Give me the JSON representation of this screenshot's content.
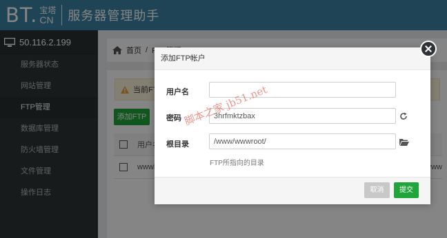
{
  "header": {
    "logo_bt": "BT.",
    "logo_cn_top": "宝塔",
    "logo_cn_bottom": "CN",
    "title": "服务器管理助手"
  },
  "sidebar": {
    "server_ip": "50.116.2.199",
    "items": [
      {
        "label": "服务器状态"
      },
      {
        "label": "网站管理"
      },
      {
        "label": "FTP管理"
      },
      {
        "label": "数据库管理"
      },
      {
        "label": "防火墙管理"
      },
      {
        "label": "文件管理"
      },
      {
        "label": "操作日志"
      }
    ],
    "active_index": 2
  },
  "breadcrumb": {
    "home": "首页",
    "separator": "/",
    "current": "FTP管理"
  },
  "main": {
    "notice_text": "当前FT",
    "add_button": "添加FTP",
    "table_header_partial": "用户名",
    "row_partial": "wwwl",
    "row_link_partial": "/www"
  },
  "modal": {
    "title": "添加FTP帐户",
    "fields": {
      "username_label": "用户名",
      "username_value": "",
      "password_label": "密码",
      "password_value": "3hrfmktzbax",
      "rootdir_label": "根目录",
      "rootdir_value": "/www/wwwroot/",
      "rootdir_help": "FTP所指向的目录"
    },
    "cancel": "取消",
    "submit": "提交"
  },
  "watermark": "脚本之家 jb51.net",
  "colors": {
    "topbar": "#3c82a6",
    "sidebar": "#2f3436",
    "primary_green": "#20a53a"
  }
}
